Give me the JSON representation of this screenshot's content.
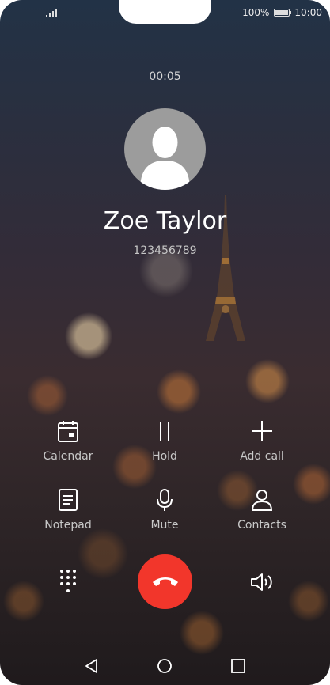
{
  "status_bar": {
    "battery_percent": "100%",
    "time": "10:00",
    "icons": [
      "signal-icon",
      "battery-icon"
    ]
  },
  "call": {
    "duration": "00:05",
    "contact_name": "Zoe Taylor",
    "phone_number": "123456789"
  },
  "actions_row1": [
    {
      "label": "Calendar",
      "icon": "calendar-icon"
    },
    {
      "label": "Hold",
      "icon": "pause-icon"
    },
    {
      "label": "Add call",
      "icon": "plus-icon"
    }
  ],
  "actions_row2": [
    {
      "label": "Notepad",
      "icon": "notepad-icon"
    },
    {
      "label": "Mute",
      "icon": "microphone-icon"
    },
    {
      "label": "Contacts",
      "icon": "person-icon"
    }
  ],
  "bottom_controls": [
    "dialpad-icon",
    "end-call-icon",
    "speaker-icon"
  ],
  "nav": [
    "back-icon",
    "home-icon",
    "recents-icon"
  ],
  "colors": {
    "end_call": "#f2362b",
    "label_text": "#c9c9c9",
    "notch": "#ffffff"
  }
}
